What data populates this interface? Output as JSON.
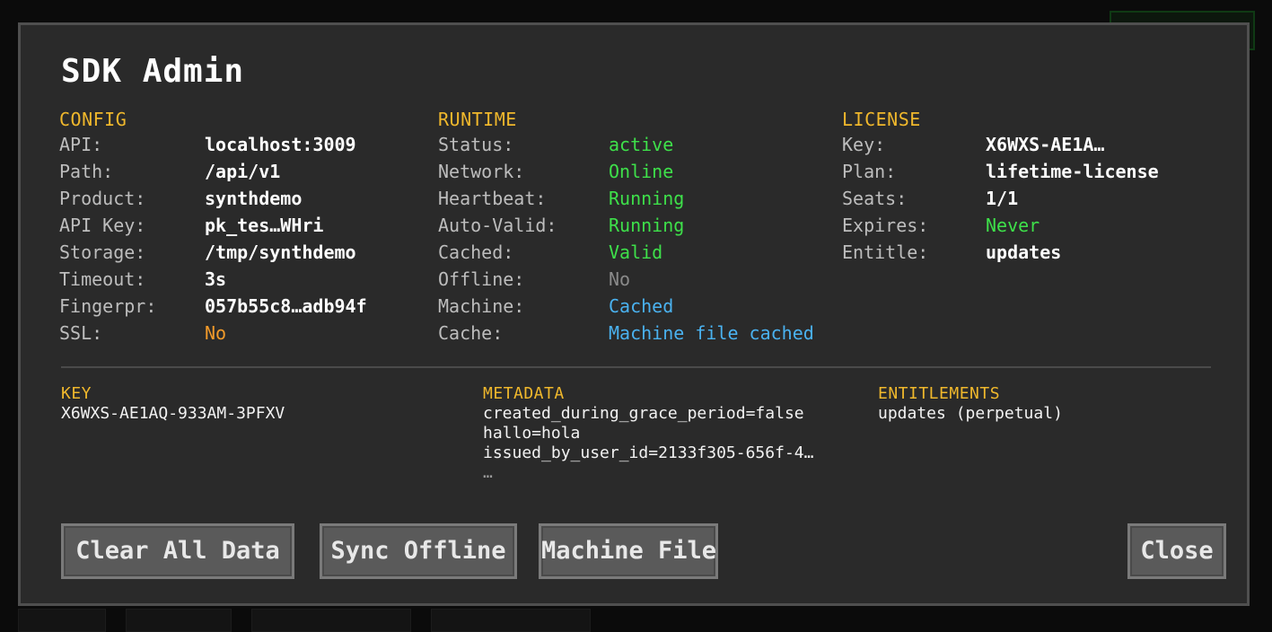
{
  "modal": {
    "title": "SDK Admin"
  },
  "config": {
    "heading": "CONFIG",
    "rows": [
      {
        "key": "API:",
        "value": "localhost:3009"
      },
      {
        "key": "Path:",
        "value": "/api/v1"
      },
      {
        "key": "Product:",
        "value": "synthdemo"
      },
      {
        "key": "API Key:",
        "value": "pk_tes…WHri"
      },
      {
        "key": "Storage:",
        "value": "/tmp/synthdemo"
      },
      {
        "key": "Timeout:",
        "value": "3s"
      },
      {
        "key": "Fingerpr:",
        "value": "057b55c8…adb94f"
      },
      {
        "key": "SSL:",
        "value": "No"
      }
    ]
  },
  "runtime": {
    "heading": "RUNTIME",
    "rows": [
      {
        "key": "Status:",
        "value": "active"
      },
      {
        "key": "Network:",
        "value": "Online"
      },
      {
        "key": "Heartbeat:",
        "value": "Running"
      },
      {
        "key": "Auto-Valid:",
        "value": "Running"
      },
      {
        "key": "Cached:",
        "value": "Valid"
      },
      {
        "key": "Offline:",
        "value": "No"
      },
      {
        "key": "Machine:",
        "value": "Cached"
      },
      {
        "key": "Cache:",
        "value": "Machine file cached"
      }
    ]
  },
  "license": {
    "heading": "LICENSE",
    "rows": [
      {
        "key": "Key:",
        "value": "X6WXS-AE1A…"
      },
      {
        "key": "Plan:",
        "value": "lifetime-license"
      },
      {
        "key": "Seats:",
        "value": "1/1"
      },
      {
        "key": "Expires:",
        "value": "Never"
      },
      {
        "key": "Entitle:",
        "value": "updates"
      }
    ]
  },
  "key_section": {
    "heading": "KEY",
    "value": "X6WXS-AE1AQ-933AM-3PFXV"
  },
  "metadata_section": {
    "heading": "METADATA",
    "lines": [
      "created_during_grace_period=false",
      "hallo=hola",
      "issued_by_user_id=2133f305-656f-4…",
      "…"
    ]
  },
  "entitlements_section": {
    "heading": "ENTITLEMENTS",
    "value": "updates (perpetual)"
  },
  "buttons": {
    "clear_all_data": "Clear All Data",
    "sync_offline": "Sync Offline",
    "machine_file": "Machine File",
    "close": "Close"
  },
  "colors": {
    "heading": "#f0b82c",
    "success": "#3ee04a",
    "warning": "#f39b2a",
    "info": "#4ab2f0",
    "muted": "#8a8a8a"
  }
}
